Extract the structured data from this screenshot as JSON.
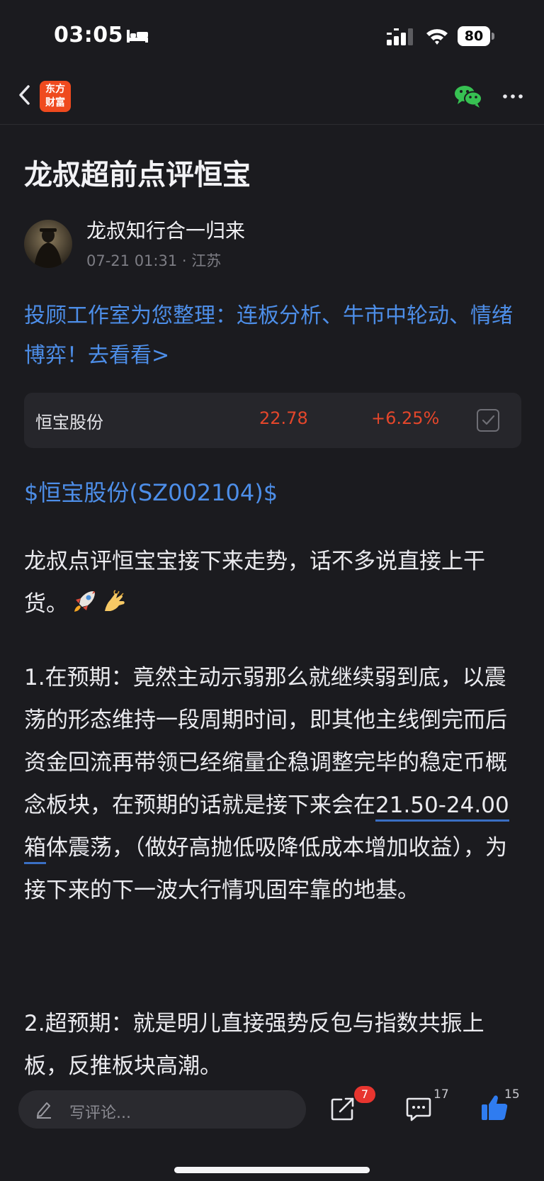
{
  "status_bar": {
    "time": "03:05",
    "battery": "80",
    "icons": [
      "bed-icon",
      "signal-icon",
      "wifi-icon",
      "battery-icon"
    ]
  },
  "nav": {
    "logo_line1": "东方",
    "logo_line2": "财富",
    "logo_color": "#ef4a1e",
    "icons": [
      "back-icon",
      "wechat-icon",
      "more-icon"
    ]
  },
  "article": {
    "title": "龙叔超前点评恒宝",
    "author": "龙叔知行合一归来",
    "meta": "07-21 01:31 · 江苏",
    "promo": "投顾工作室为您整理：连板分析、牛市中轮动、情绪博弈！去看看>",
    "stock_card": {
      "name": "恒宝股份",
      "price": "22.78",
      "change": "+6.25%"
    },
    "stock_tag": "$恒宝股份(SZ002104)$",
    "p1": "龙叔点评恒宝宝接下来走势，话不多说直接上干货。",
    "p2_before": "1.在预期：竟然主动示弱那么就继续弱到底，以震荡的形态维持一段周期时间，即其他主线倒完而后资金回流再带领已经缩量企稳调整完毕的稳定币概念板块，在预期的话就是接下来会在",
    "p2_highlight": "21.50-24.00箱",
    "p2_after": "体震荡，（做好高抛低吸降低成本增加收益），为接下来的下一波大行情巩固牢靠的地基。",
    "p3": "2.超预期：就是明儿直接强势反包与指数共振上板，反推板块高潮。"
  },
  "bottom_bar": {
    "comment_placeholder": "写评论...",
    "share_count": "7",
    "comment_count": "17",
    "like_count": "15"
  },
  "colors": {
    "background": "#1b1b1f",
    "link": "#4d8ee8",
    "up": "#e3462b",
    "like": "#2f7cf0"
  }
}
